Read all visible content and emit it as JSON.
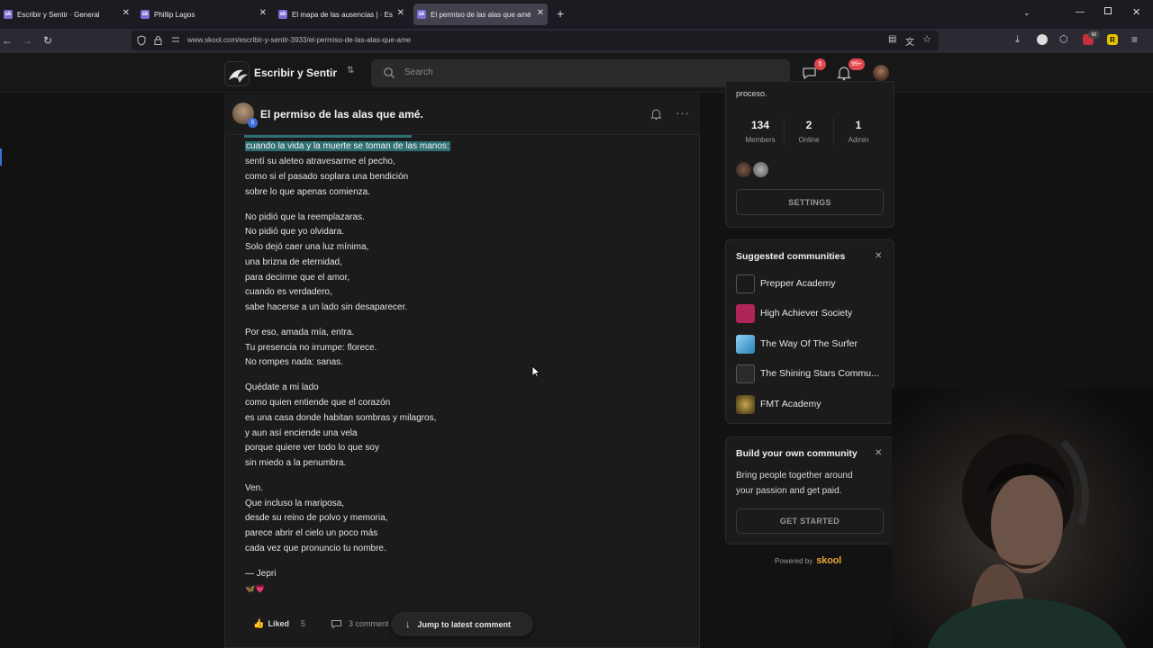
{
  "browser": {
    "tabs": [
      {
        "label": "Escribir y Sentir · General",
        "active": false
      },
      {
        "label": "Phillip Lagos",
        "active": false
      },
      {
        "label": "El mapa de las ausencias | · Escr",
        "active": false
      },
      {
        "label": "El permiso de las alas que amé",
        "active": true
      }
    ],
    "favicon_text": "sk",
    "new_tab": "+",
    "url": "www.skool.com/escribir-y-sentir-3933/el-permiso-de-las-alas-que-ame",
    "extension_badge": "60",
    "extension_letter": "R"
  },
  "header": {
    "group_name": "Escribir y Sentir",
    "search_placeholder": "Search",
    "chat_badge": "5",
    "notif_badge": "99+"
  },
  "post": {
    "title": "El permiso de las alas que amé.",
    "author_level": "5",
    "lines": {
      "l0": "cuando la vida y la muerte se toman de las manos:",
      "l1": "sentí su aleteo atravesarme el pecho,",
      "l2": "como si el pasado soplara una bendición",
      "l3": "sobre lo que apenas comienza.",
      "l4": "No pidió que la reemplazaras.",
      "l5": "No pidió que yo olvidara.",
      "l6": "Solo dejó caer una luz mínima,",
      "l7": "una brizna de eternidad,",
      "l8": "para decirme que el amor,",
      "l9": "cuando es verdadero,",
      "l10": "sabe hacerse a un lado sin desaparecer.",
      "l11": "Por eso, amada mía, entra.",
      "l12": "Tu presencia no irrumpe: florece.",
      "l13": "No rompes nada: sanas.",
      "l14": "Quédate a mi lado",
      "l15": "como quien entiende que el corazón",
      "l16": "es una casa donde habitan sombras y milagros,",
      "l17": "y aun así enciende una vela",
      "l18": "porque quiere ver todo lo que soy",
      "l19": "sin miedo a la penumbra.",
      "l20": "Ven.",
      "l21": "Que incluso la mariposa,",
      "l22": "desde su reino de polvo y memoria,",
      "l23": "parece abrir el cielo un poco más",
      "l24": "cada vez que pronuncio tu nombre.",
      "l25": "— Jepri",
      "l26": "🦋💗"
    },
    "liked_label": "Liked",
    "like_count": "5",
    "comments_label": "3 comment",
    "jump_label": "Jump to latest comment"
  },
  "sidebar": {
    "desc_tail": "proceso.",
    "stats": [
      {
        "value": "134",
        "label": "Members"
      },
      {
        "value": "2",
        "label": "Online"
      },
      {
        "value": "1",
        "label": "Admin"
      }
    ],
    "settings_label": "SETTINGS",
    "suggested_title": "Suggested communities",
    "communities": [
      {
        "name": "Prepper Academy",
        "color": "#2a2a2a"
      },
      {
        "name": "High Achiever Society",
        "color": "#b0245a"
      },
      {
        "name": "The Way Of The Surfer",
        "color": "#4aa3c9"
      },
      {
        "name": "The Shining Stars Commu...",
        "color": "#3a3a3a"
      },
      {
        "name": "FMT Academy",
        "color": "#c9a54a"
      }
    ],
    "build_title": "Build your own community",
    "build_text_1": "Bring people together around",
    "build_text_2": "your passion and get paid.",
    "get_started": "GET STARTED",
    "powered_by": "Powered by",
    "brand": "skool",
    "close_glyph": "✕"
  }
}
